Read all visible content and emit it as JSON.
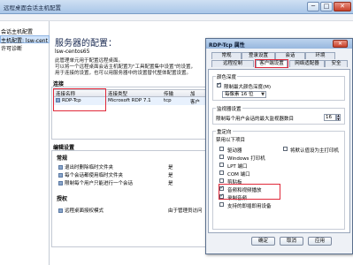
{
  "window": {
    "title": "远程桌面会话主机配置",
    "min_glyph": "─",
    "max_glyph": "□",
    "close_glyph": "✕"
  },
  "tree": {
    "items": [
      {
        "label": "会话主机配置"
      },
      {
        "label": "主机配置: lsw-cent"
      },
      {
        "label": "许可诊断"
      }
    ]
  },
  "main": {
    "heading": "服务器的配置：",
    "server_name": "lsw-centos65",
    "description": [
      "此管理单元用于配置远程桌面。",
      "可以将一个远程桌面会话主机配置为\"工具配置集中设置\"的设置，",
      "用于连接的设置，也可以用服务器中的设置替代整体配置设置。"
    ],
    "connections_label": "连接",
    "table": {
      "headers": [
        "连接名称",
        "连接类型",
        "传输",
        "加"
      ],
      "row": [
        "RDP-Tcp",
        "Microsoft RDP 7.1",
        "tcp",
        "客户"
      ]
    },
    "edit_label": "编辑设置",
    "general_group": "常规",
    "general_rows": [
      {
        "label": "退出时删除临时文件夹",
        "value": "是"
      },
      {
        "label": "每个会话都使用临时文件夹",
        "value": "是"
      },
      {
        "label": "限制每个用户只能进行一个会话",
        "value": "是"
      }
    ],
    "license_group": "授权",
    "license_rows": [
      {
        "label": "远程桌面授权模式",
        "value": "由于管理员访问"
      }
    ]
  },
  "dialog": {
    "title": "RDP-Tcp 属性",
    "close_glyph": "✕",
    "tabs_row1": [
      "常规",
      "登录设置",
      "会话",
      "环境"
    ],
    "tabs_row2": [
      "远程控制",
      "客户端设置",
      "网络适配器",
      "安全"
    ],
    "color_depth": {
      "legend": "颜色深度",
      "limit_label": "限制最大颜色深度(M)",
      "select_value": "每像素 16 位"
    },
    "monitor": {
      "legend": "监视器设置",
      "label": "限制每个用户会话的最大监视器数目",
      "value": "16"
    },
    "redirect": {
      "legend": "重定向",
      "disable_label": "禁用以下项目",
      "options_left": [
        {
          "label": "驱动器",
          "checked": false
        },
        {
          "label": "Windows 打印机",
          "checked": false
        },
        {
          "label": "LPT 端口",
          "checked": false
        },
        {
          "label": "COM 端口",
          "checked": false
        },
        {
          "label": "剪贴板",
          "checked": false
        },
        {
          "label": "音频和视频播放",
          "checked": true
        },
        {
          "label": "录制音频",
          "checked": true
        },
        {
          "label": "支持的即插即用设备",
          "checked": false
        }
      ],
      "options_right": [
        {
          "label": "将默认值设为主打印机",
          "checked": false
        }
      ]
    },
    "buttons": {
      "ok": "确定",
      "cancel": "取消",
      "apply": "应用"
    }
  }
}
